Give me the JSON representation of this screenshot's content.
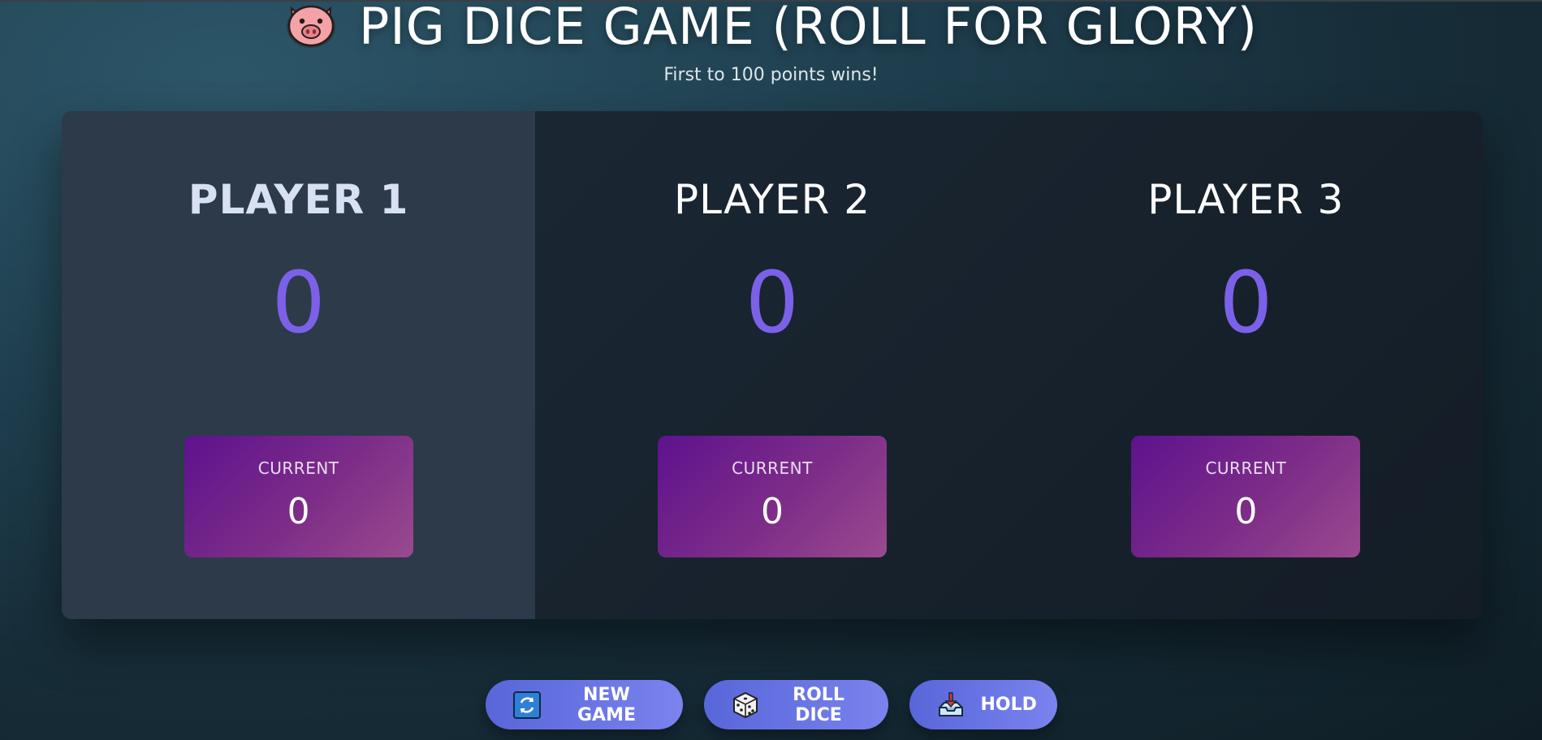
{
  "header": {
    "title": "PIG DICE GAME (ROLL FOR GLORY)",
    "title_icon": "pig-face-icon",
    "subtitle": "First to 100 points wins!"
  },
  "players": [
    {
      "name": "PLAYER 1",
      "score": "0",
      "current_label": "CURRENT",
      "current": "0",
      "active": true
    },
    {
      "name": "PLAYER 2",
      "score": "0",
      "current_label": "CURRENT",
      "current": "0",
      "active": false
    },
    {
      "name": "PLAYER 3",
      "score": "0",
      "current_label": "CURRENT",
      "current": "0",
      "active": false
    }
  ],
  "controls": {
    "new_game": {
      "label": "NEW GAME",
      "icon": "refresh-icon"
    },
    "roll_dice": {
      "label": "ROLL DICE",
      "icon": "dice-icon"
    },
    "hold": {
      "label": "HOLD",
      "icon": "inbox-tray-icon"
    }
  },
  "colors": {
    "score": "#7b61e8",
    "active_panel": "#2d3a4a",
    "button_gradient_start": "#5866d9",
    "button_gradient_end": "#7a83ee",
    "current_box_start": "#5e128e",
    "current_box_end": "#9a4a8e"
  }
}
